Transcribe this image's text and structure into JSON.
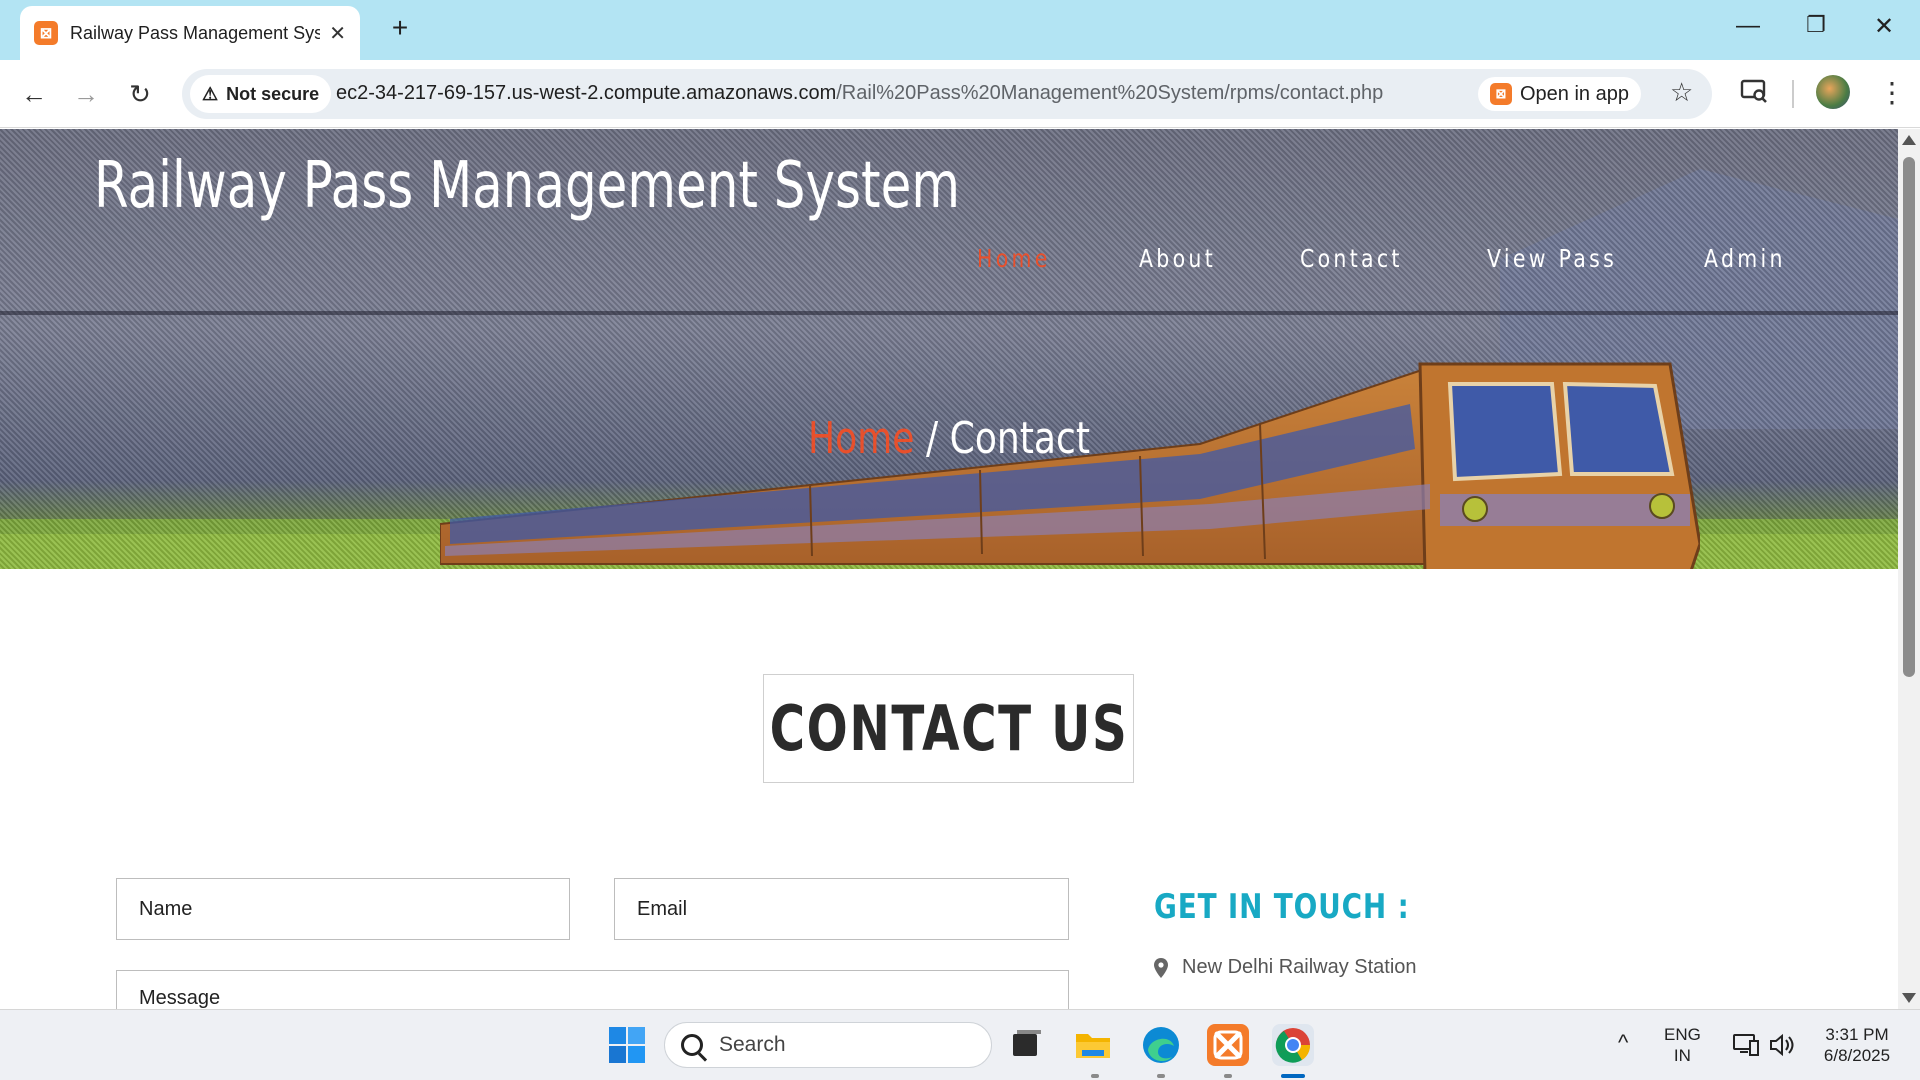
{
  "browser": {
    "tab_title": "Railway Pass Management System",
    "tab_favicon_text": "⊠",
    "new_tab": "+",
    "window": {
      "minimize": "—",
      "restore": "❐",
      "close": "✕"
    },
    "nav": {
      "back": "←",
      "forward": "→",
      "reload": "↻"
    },
    "security_label": "Not secure",
    "url_host": "ec2-34-217-69-157.us-west-2.compute.amazonaws.com",
    "url_path": "/Rail%20Pass%20Management%20System/rpms/contact.php",
    "open_in_app": "Open in app",
    "bookmark": "☆",
    "menu": "⋮"
  },
  "site": {
    "title": "Railway Pass Management System",
    "nav": [
      {
        "label": "Home",
        "active": true
      },
      {
        "label": "About",
        "active": false
      },
      {
        "label": "Contact",
        "active": false
      },
      {
        "label": "View Pass",
        "active": false
      },
      {
        "label": "Admin",
        "active": false
      }
    ],
    "breadcrumb": {
      "home": "Home",
      "separator": "/",
      "current": "Contact"
    },
    "accent_color": "#e8502c"
  },
  "contact": {
    "heading": "CONTACT US",
    "form": {
      "name_placeholder": "Name",
      "email_placeholder": "Email",
      "message_placeholder": "Message"
    },
    "get_in_touch": "GET IN TOUCH :",
    "address": "New Delhi Railway Station",
    "heading_color": "#18a9c4"
  },
  "taskbar": {
    "search_placeholder": "Search",
    "language_line1": "ENG",
    "language_line2": "IN",
    "time": "3:31 PM",
    "date": "6/8/2025",
    "tray_chevron": "^"
  }
}
